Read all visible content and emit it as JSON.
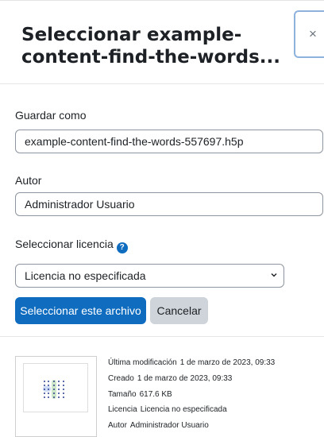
{
  "dialog": {
    "title": "Seleccionar example-content-find-the-words...",
    "close_icon": "close-icon",
    "close_glyph": "×"
  },
  "form": {
    "save_as": {
      "label": "Guardar como",
      "value": "example-content-find-the-words-557697.h5p"
    },
    "author": {
      "label": "Autor",
      "value": "Administrador Usuario"
    },
    "license": {
      "label": "Seleccionar licencia",
      "help_icon": "question-circle-icon",
      "help_glyph": "?",
      "selected": "Licencia no especificada"
    }
  },
  "buttons": {
    "select_label": "Seleccionar este archivo",
    "cancel_label": "Cancelar"
  },
  "file_info": {
    "thumbnail_icon": "h5p-grid-icon",
    "modified": {
      "label": "Última modificación",
      "value": "1 de marzo de 2023, 09:33"
    },
    "created": {
      "label": "Creado",
      "value": "1 de marzo de 2023, 09:33"
    },
    "size": {
      "label": "Tamaño",
      "value": "617.6 KB"
    },
    "license": {
      "label": "Licencia",
      "value": "Licencia no especificada"
    },
    "author": {
      "label": "Autor",
      "value": "Administrador Usuario"
    }
  },
  "colors": {
    "primary": "#0f6cbf",
    "secondary": "#ced4da",
    "border": "#8f959e",
    "text": "#1d2125"
  }
}
